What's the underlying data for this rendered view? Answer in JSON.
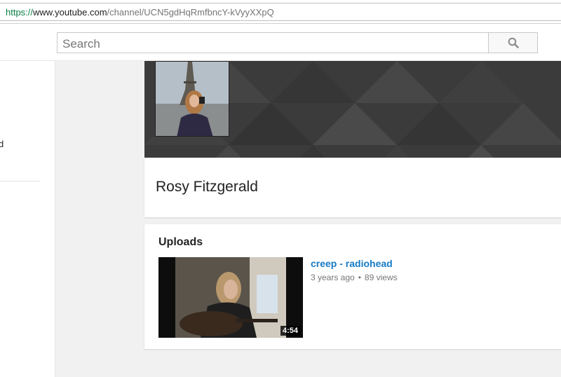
{
  "browser": {
    "url_scheme": "https://",
    "url_host": "www.youtube.com",
    "url_path": "/channel/UCN5gdHqRmfbncY-kVyyXXpQ"
  },
  "masthead": {
    "search_placeholder": "Search"
  },
  "guide": {
    "partial_item_text": "d"
  },
  "channel": {
    "name": "Rosy Fitzgerald"
  },
  "uploads": {
    "heading": "Uploads",
    "videos": [
      {
        "title": "creep - radiohead",
        "age": "3 years ago",
        "separator": "•",
        "views": "89 views",
        "duration": "4:54"
      }
    ]
  },
  "colors": {
    "link": "#167ac6",
    "banner": "#3d3d3d",
    "url_scheme": "#0b8043"
  }
}
